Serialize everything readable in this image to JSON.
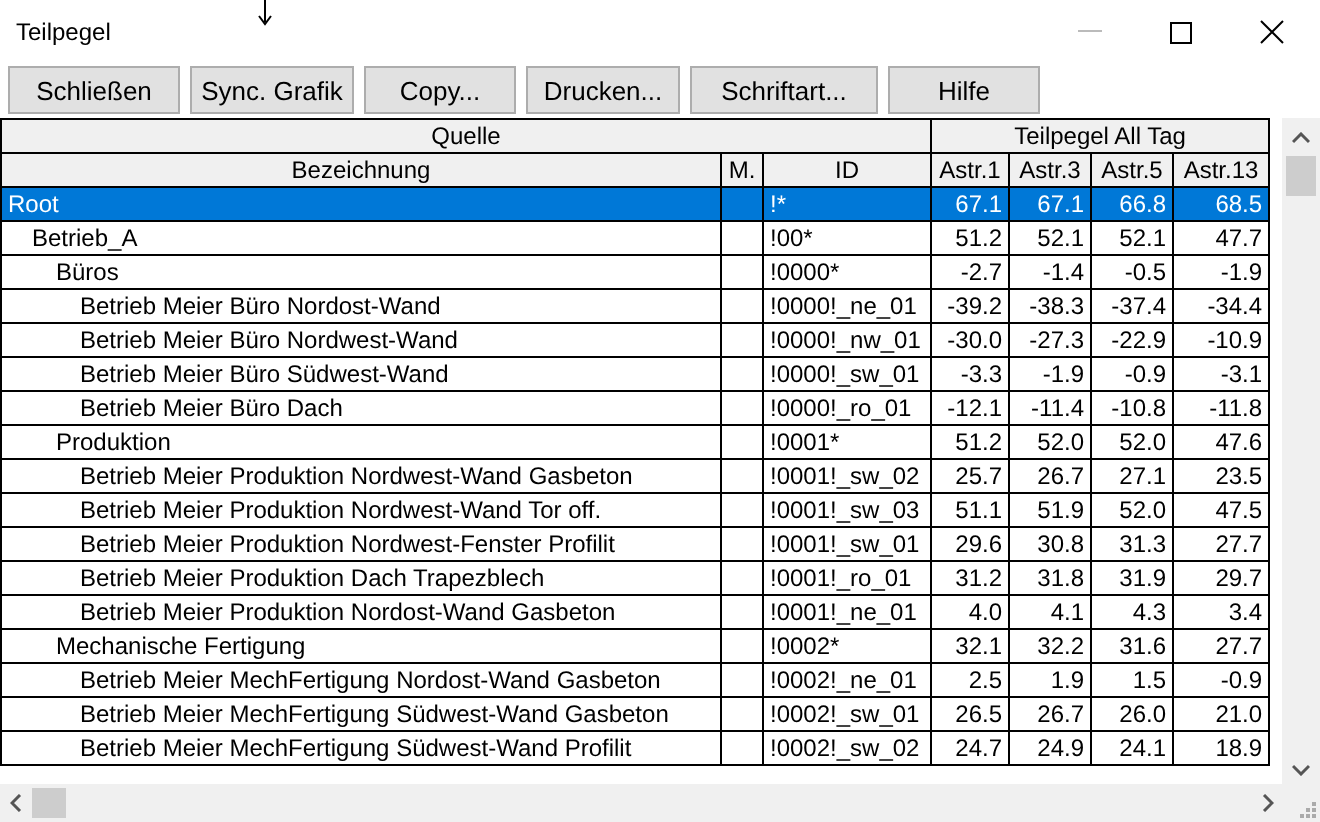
{
  "window": {
    "title": "Teilpegel"
  },
  "toolbar": [
    "Schließen",
    "Sync. Grafik",
    "Copy...",
    "Drucken...",
    "Schriftart...",
    "Hilfe"
  ],
  "table": {
    "group_headers": [
      "Quelle",
      "Teilpegel All Tag"
    ],
    "columns": [
      "Bezeichnung",
      "M.",
      "ID",
      "Astr.1",
      "Astr.3",
      "Astr.5",
      "Astr.13"
    ],
    "rows": [
      {
        "name": "Root",
        "id": "!*",
        "values": [
          "67.1",
          "67.1",
          "66.8",
          "68.5"
        ],
        "selected": true,
        "children": [
          {
            "name": "Betrieb_A",
            "id": "!00*",
            "values": [
              "51.2",
              "52.1",
              "52.1",
              "47.7"
            ],
            "selected": false,
            "children": [
              {
                "name": "Büros",
                "id": "!0000*",
                "values": [
                  "-2.7",
                  "-1.4",
                  "-0.5",
                  "-1.9"
                ],
                "selected": false,
                "children": [
                  {
                    "name": "Betrieb Meier Büro Nordost-Wand",
                    "id": "!0000!_ne_01",
                    "values": [
                      "-39.2",
                      "-38.3",
                      "-37.4",
                      "-34.4"
                    ],
                    "selected": false
                  },
                  {
                    "name": "Betrieb Meier Büro Nordwest-Wand",
                    "id": "!0000!_nw_01",
                    "values": [
                      "-30.0",
                      "-27.3",
                      "-22.9",
                      "-10.9"
                    ],
                    "selected": false
                  },
                  {
                    "name": "Betrieb Meier Büro Südwest-Wand",
                    "id": "!0000!_sw_01",
                    "values": [
                      "-3.3",
                      "-1.9",
                      "-0.9",
                      "-3.1"
                    ],
                    "selected": false
                  },
                  {
                    "name": "Betrieb Meier Büro Dach",
                    "id": "!0000!_ro_01",
                    "values": [
                      "-12.1",
                      "-11.4",
                      "-10.8",
                      "-11.8"
                    ],
                    "selected": false
                  }
                ]
              },
              {
                "name": "Produktion",
                "id": "!0001*",
                "values": [
                  "51.2",
                  "52.0",
                  "52.0",
                  "47.6"
                ],
                "selected": false,
                "children": [
                  {
                    "name": "Betrieb Meier Produktion Nordwest-Wand Gasbeton",
                    "id": "!0001!_sw_02",
                    "values": [
                      "25.7",
                      "26.7",
                      "27.1",
                      "23.5"
                    ],
                    "selected": false
                  },
                  {
                    "name": "Betrieb Meier Produktion Nordwest-Wand Tor off.",
                    "id": "!0001!_sw_03",
                    "values": [
                      "51.1",
                      "51.9",
                      "52.0",
                      "47.5"
                    ],
                    "selected": false
                  },
                  {
                    "name": "Betrieb Meier Produktion Nordwest-Fenster Profilit",
                    "id": "!0001!_sw_01",
                    "values": [
                      "29.6",
                      "30.8",
                      "31.3",
                      "27.7"
                    ],
                    "selected": false
                  },
                  {
                    "name": "Betrieb Meier Produktion Dach Trapezblech",
                    "id": "!0001!_ro_01",
                    "values": [
                      "31.2",
                      "31.8",
                      "31.9",
                      "29.7"
                    ],
                    "selected": false
                  },
                  {
                    "name": "Betrieb Meier Produktion Nordost-Wand Gasbeton",
                    "id": "!0001!_ne_01",
                    "values": [
                      "4.0",
                      "4.1",
                      "4.3",
                      "3.4"
                    ],
                    "selected": false
                  }
                ]
              },
              {
                "name": "Mechanische Fertigung",
                "id": "!0002*",
                "values": [
                  "32.1",
                  "32.2",
                  "31.6",
                  "27.7"
                ],
                "selected": false,
                "children": [
                  {
                    "name": "Betrieb Meier MechFertigung Nordost-Wand Gasbeton",
                    "id": "!0002!_ne_01",
                    "values": [
                      "2.5",
                      "1.9",
                      "1.5",
                      "-0.9"
                    ],
                    "selected": false
                  },
                  {
                    "name": "Betrieb Meier MechFertigung Südwest-Wand Gasbeton",
                    "id": "!0002!_sw_01",
                    "values": [
                      "26.5",
                      "26.7",
                      "26.0",
                      "21.0"
                    ],
                    "selected": false
                  },
                  {
                    "name": "Betrieb Meier MechFertigung Südwest-Wand Profilit",
                    "id": "!0002!_sw_02",
                    "values": [
                      "24.7",
                      "24.9",
                      "24.1",
                      "18.9"
                    ],
                    "selected": false
                  }
                ]
              }
            ]
          }
        ]
      }
    ]
  }
}
